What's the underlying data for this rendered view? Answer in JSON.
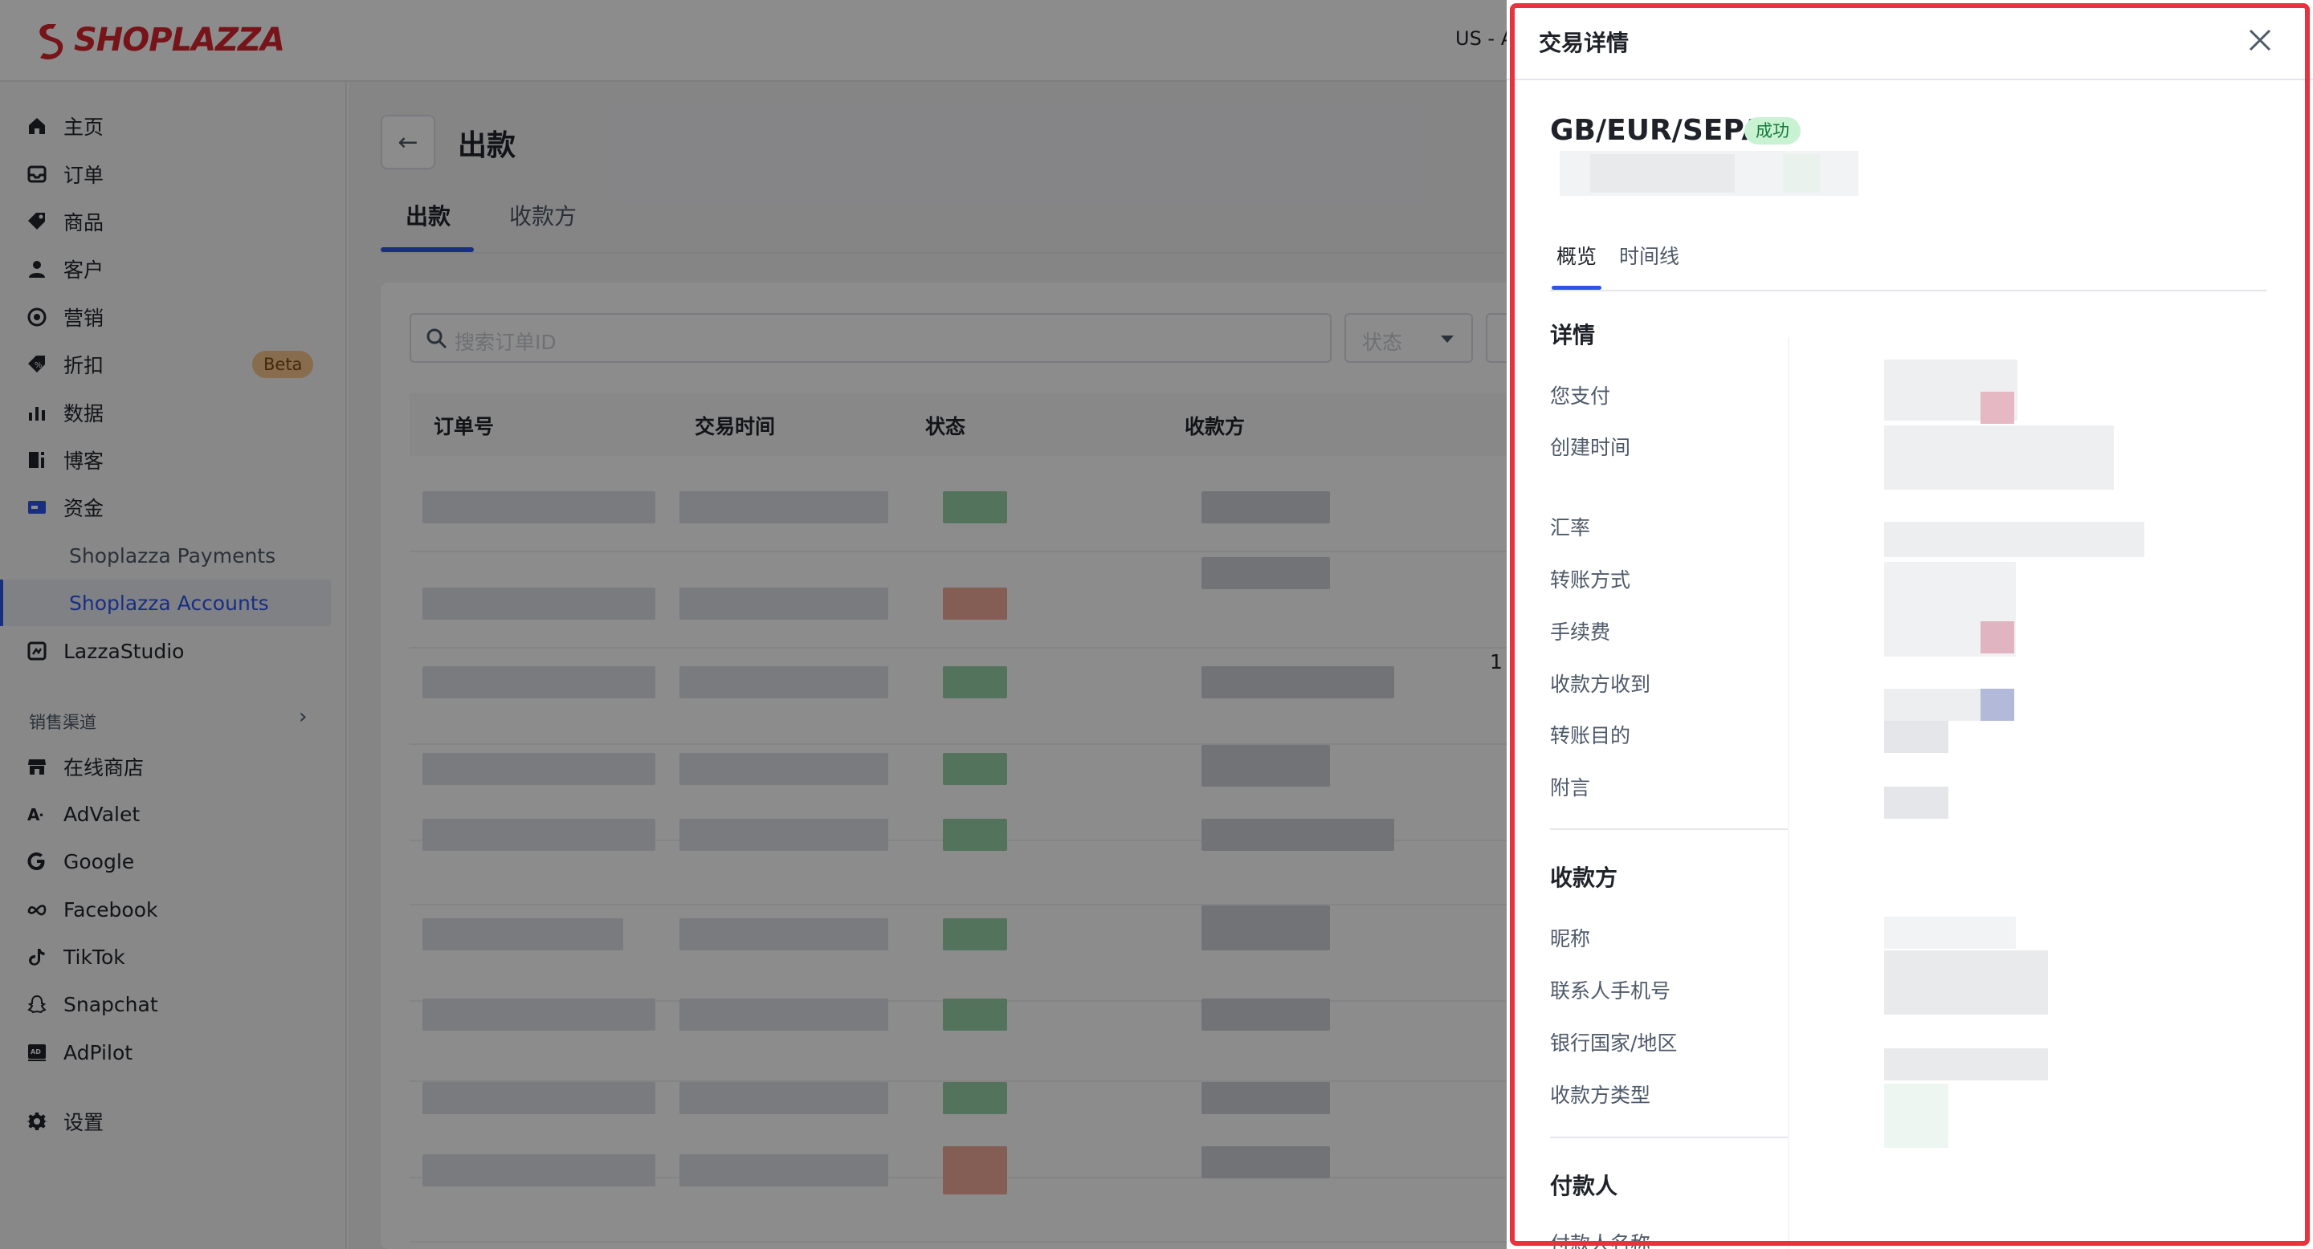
{
  "brand": {
    "name": "SHOPLAZZA"
  },
  "topbar": {
    "store_code": "US - A"
  },
  "sidebar": {
    "items": [
      {
        "label": "主页",
        "icon": "home-icon"
      },
      {
        "label": "订单",
        "icon": "inbox-icon"
      },
      {
        "label": "商品",
        "icon": "tag-icon"
      },
      {
        "label": "客户",
        "icon": "user-icon"
      },
      {
        "label": "营销",
        "icon": "target-icon"
      },
      {
        "label": "折扣",
        "icon": "discount-icon",
        "badge": "Beta"
      },
      {
        "label": "数据",
        "icon": "bar-chart-icon"
      },
      {
        "label": "博客",
        "icon": "blog-icon"
      },
      {
        "label": "资金",
        "icon": "wallet-icon"
      }
    ],
    "sub_items": [
      {
        "label": "Shoplazza Payments"
      },
      {
        "label": "Shoplazza Accounts"
      }
    ],
    "lazzastudio": {
      "label": "LazzaStudio"
    },
    "channels_title": "销售渠道",
    "channels": [
      {
        "label": "在线商店"
      },
      {
        "label": "AdValet"
      },
      {
        "label": "Google"
      },
      {
        "label": "Facebook"
      },
      {
        "label": "TikTok"
      },
      {
        "label": "Snapchat"
      },
      {
        "label": "AdPilot"
      }
    ],
    "settings": {
      "label": "设置"
    }
  },
  "page": {
    "title": "出款",
    "tabs": [
      {
        "label": "出款"
      },
      {
        "label": "收款方"
      }
    ],
    "search": {
      "placeholder": "搜索订单ID"
    },
    "status_filter": {
      "placeholder": "状态"
    },
    "columns": [
      "订单号",
      "交易时间",
      "状态",
      "收款方"
    ],
    "row_cut_text": "1"
  },
  "drawer": {
    "title": "交易详情",
    "transaction": {
      "route": "GB/EUR/SEPA",
      "status": "成功"
    },
    "tabs": [
      {
        "label": "概览"
      },
      {
        "label": "时间线"
      }
    ],
    "details_section": {
      "title": "详情",
      "fields": [
        "您支付",
        "创建时间",
        "汇率",
        "转账方式",
        "手续费",
        "收款方收到",
        "转账目的",
        "附言"
      ]
    },
    "payee_section": {
      "title": "收款方",
      "fields": [
        "昵称",
        "联系人手机号",
        "银行国家/地区",
        "收款方类型"
      ]
    },
    "payer_section": {
      "title": "付款人",
      "fields": [
        "付款人名称"
      ]
    }
  },
  "colors": {
    "accent": "#2f54eb",
    "brand": "#d8262f",
    "success_badge_bg": "#c9f2d3",
    "success_badge_fg": "#157a3a",
    "highlight_outline": "#e8323e",
    "beta_badge": "#f8c58e"
  }
}
